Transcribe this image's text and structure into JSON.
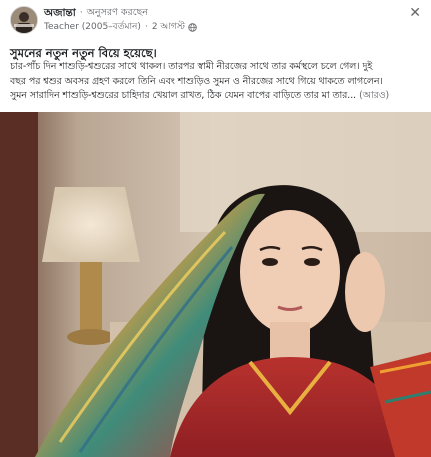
{
  "post": {
    "author": "অজান্তা",
    "follow": "অনুসরণ করছেন",
    "subtitle": "Teacher (2005–বর্তমান)",
    "time": "2 আগস্ট",
    "title": "সুমনের নতুন নতুন বিয়ে হয়েছে।",
    "body_lines": [
      "চার-পাঁচ দিন শাশুড়ি-শ্বশুরের সাথে থাকল। তারপর স্বামী নীরজের সাথে তার কর্মস্থলে চলে গেল। দুই",
      "বছর পর শ্বশুর অবসর গ্রহণ করলে তিনি এবং শাশুড়িও সুমন ও নীরজের সাথে গিয়ে থাকতে লাগলেন।",
      "সুমন সারাদিন শাশুড়ি-শ্বশুরের চাহিদার খেয়াল রাখত, ঠিক যেমন বাপের বাড়িতে তার মা তার..."
    ],
    "see_more": "(আরও)",
    "close_symbol": "✕"
  },
  "icons": {
    "avatar": "avatar-image",
    "globe": "globe-icon",
    "close": "close-icon"
  }
}
